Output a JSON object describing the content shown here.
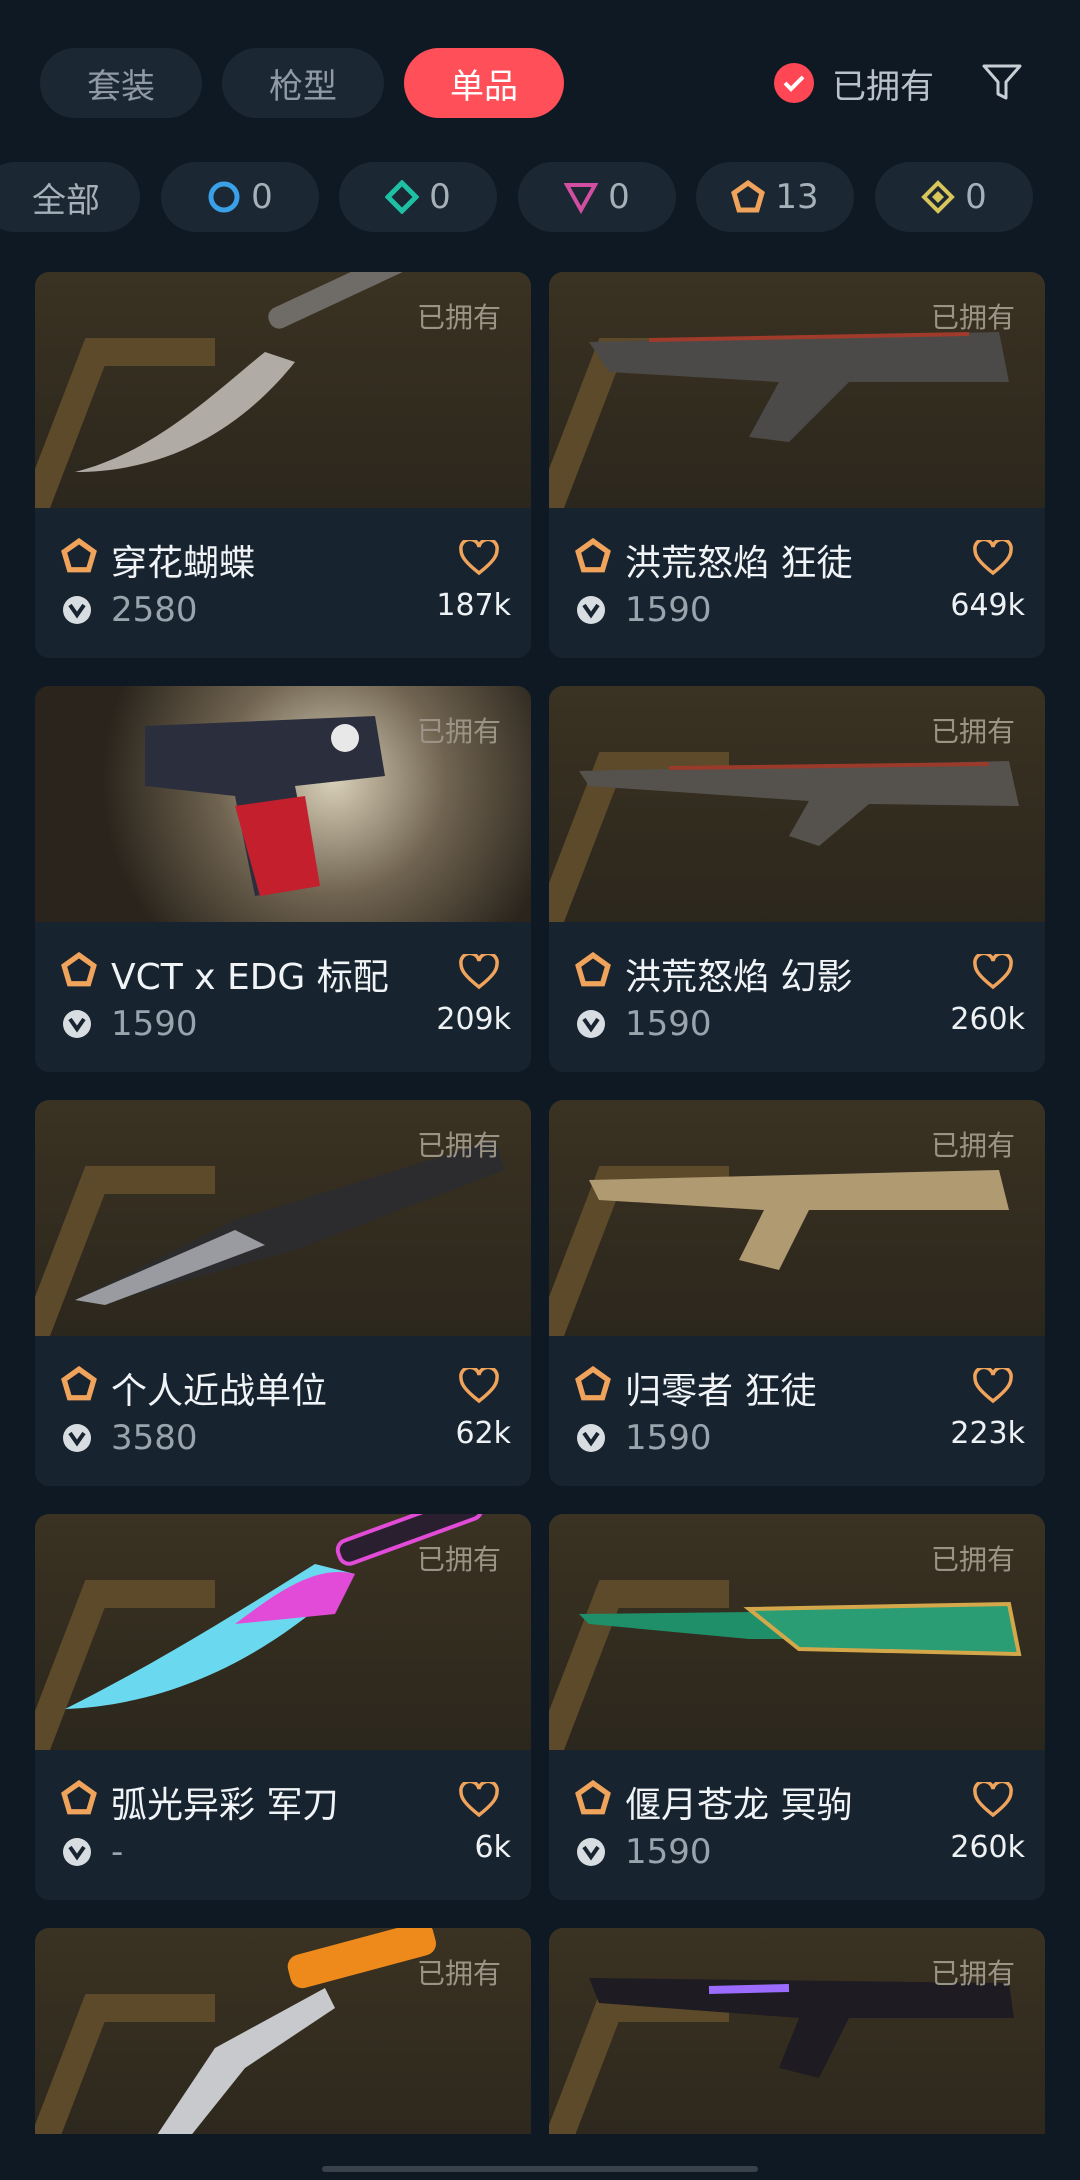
{
  "tabs": [
    {
      "label": "套装",
      "active": false
    },
    {
      "label": "枪型",
      "active": false
    },
    {
      "label": "单品",
      "active": true
    }
  ],
  "owned_filter": {
    "label": "已拥有",
    "checked": true
  },
  "tiers": [
    {
      "label": "全部",
      "icon": "all"
    },
    {
      "label": "0",
      "icon": "select-tier-icon",
      "color": "#3aa0e8"
    },
    {
      "label": "0",
      "icon": "deluxe-tier-icon",
      "color": "#1fbfa4"
    },
    {
      "label": "0",
      "icon": "premium-tier-icon",
      "color": "#d14ea0"
    },
    {
      "label": "13",
      "icon": "exclusive-tier-icon",
      "color": "#f0a35a"
    },
    {
      "label": "0",
      "icon": "ultra-tier-icon",
      "color": "#d8c65a"
    }
  ],
  "cards": [
    {
      "name": "穿花蝴蝶",
      "price": "2580",
      "likes": "187k",
      "owned": "已拥有"
    },
    {
      "name": "洪荒怒焰 狂徒",
      "price": "1590",
      "likes": "649k",
      "owned": "已拥有"
    },
    {
      "name": "VCT x EDG 标配",
      "price": "1590",
      "likes": "209k",
      "owned": "已拥有"
    },
    {
      "name": "洪荒怒焰 幻影",
      "price": "1590",
      "likes": "260k",
      "owned": "已拥有"
    },
    {
      "name": "个人近战单位",
      "price": "3580",
      "likes": "62k",
      "owned": "已拥有"
    },
    {
      "name": "归零者 狂徒",
      "price": "1590",
      "likes": "223k",
      "owned": "已拥有"
    },
    {
      "name": "弧光异彩 军刀",
      "price": "-",
      "likes": "6k",
      "owned": "已拥有"
    },
    {
      "name": "偃月苍龙 冥驹",
      "price": "1590",
      "likes": "260k",
      "owned": "已拥有"
    },
    {
      "name": "",
      "price": "",
      "likes": "",
      "owned": "已拥有"
    },
    {
      "name": "",
      "price": "",
      "likes": "",
      "owned": "已拥有"
    }
  ],
  "colors": {
    "accent": "#ff4f58",
    "tier": "#f0a35a",
    "background": "#0f1923"
  }
}
